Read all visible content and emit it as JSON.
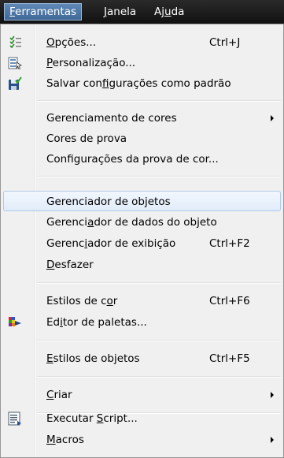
{
  "menubar": {
    "items": [
      {
        "pre": "",
        "u": "F",
        "post": "erramentas"
      },
      {
        "pre": "",
        "u": "J",
        "post": "anela"
      },
      {
        "pre": "Aj",
        "u": "u",
        "post": "da"
      }
    ]
  },
  "menu": {
    "items": [
      {
        "pre": "",
        "u": "O",
        "post": "pções...",
        "shortcut": "Ctrl+J",
        "icon": "options-icon"
      },
      {
        "pre": "",
        "u": "P",
        "post": "ersonalização...",
        "icon": "customize-icon"
      },
      {
        "pre": "Salvar con",
        "u": "f",
        "post": "igurações como padrão",
        "icon": "save-defaults-icon"
      },
      {
        "pre": "Gerenciamento de cores",
        "u": "",
        "post": ""
      },
      {
        "pre": "Cores de prova",
        "u": "",
        "post": ""
      },
      {
        "pre": "Configurações da prova de cor...",
        "u": "",
        "post": ""
      },
      {
        "pre": "Gerenciador de objetos",
        "u": "",
        "post": ""
      },
      {
        "pre": "Gerenci",
        "u": "a",
        "post": "dor de dados do objeto"
      },
      {
        "pre": "Gerenc",
        "u": "i",
        "post": "ador de exibição",
        "shortcut": "Ctrl+F2"
      },
      {
        "pre": "",
        "u": "D",
        "post": "esfazer"
      },
      {
        "pre": "Estilos de c",
        "u": "o",
        "post": "r",
        "shortcut": "Ctrl+F6"
      },
      {
        "pre": "Ed",
        "u": "i",
        "post": "tor de paletas...",
        "icon": "palette-editor-icon"
      },
      {
        "pre": "",
        "u": "E",
        "post": "stilos de objetos",
        "shortcut": "Ctrl+F5"
      },
      {
        "pre": "",
        "u": "C",
        "post": "riar"
      },
      {
        "pre": "Executar ",
        "u": "S",
        "post": "cript...",
        "icon": "run-script-icon"
      },
      {
        "pre": "",
        "u": "M",
        "post": "acros"
      }
    ]
  },
  "colors": {
    "menubar_bg": "#1a1a1a",
    "menubar_active": "#4a73a2",
    "menu_bg": "#f0f0f0",
    "hover_bg": "#e8f0fb",
    "hover_border": "#b0c9e8"
  }
}
